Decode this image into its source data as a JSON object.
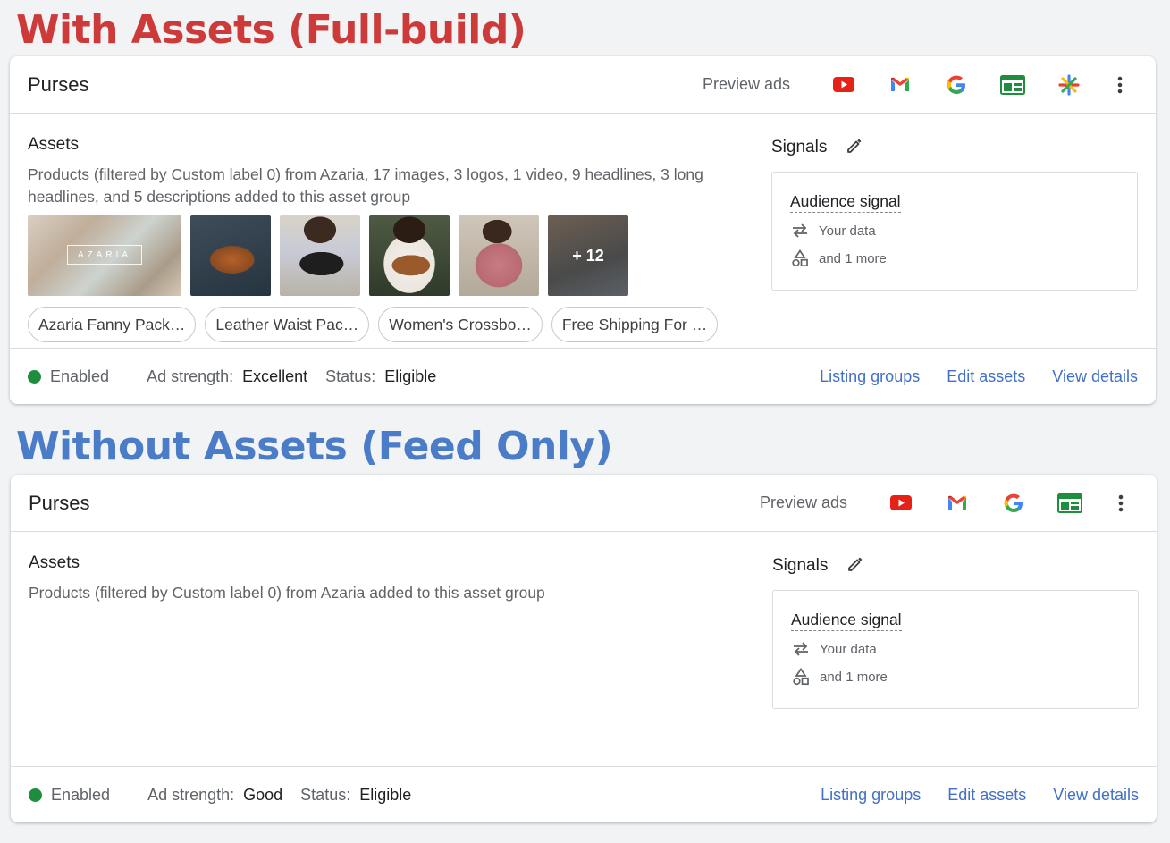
{
  "headings": {
    "with_assets": "With Assets (Full-build)",
    "without_assets": "Without Assets (Feed Only)"
  },
  "colors": {
    "heading_red": "#cc3a3a",
    "heading_blue": "#4a7cc8",
    "link_blue": "#4170c9",
    "enabled_green": "#1e8e3e"
  },
  "card1": {
    "title": "Purses",
    "preview_label": "Preview ads",
    "icons": [
      "youtube-icon",
      "gmail-icon",
      "google-search-icon",
      "display-network-icon",
      "discover-icon",
      "more-vert-icon"
    ],
    "assets_title": "Assets",
    "assets_desc": "Products (filtered by Custom label 0) from Azaria, 17 images, 3 logos, 1 video, 9 headlines, 3 long headlines, and 5 descriptions added to this asset group",
    "thumb_brand": "AZARIA",
    "thumb_more": "+ 12",
    "chips": [
      "Azaria Fanny Pack…",
      "Leather Waist Pac…",
      "Women's Crossbo…",
      "Free Shipping For …"
    ],
    "signals_title": "Signals",
    "audience_label": "Audience signal",
    "your_data": "Your data",
    "and_more": "and 1 more",
    "enabled": "Enabled",
    "ad_strength_label": "Ad strength:",
    "ad_strength_value": "Excellent",
    "status_label": "Status:",
    "status_value": "Eligible",
    "links": {
      "listing_groups": "Listing groups",
      "edit_assets": "Edit assets",
      "view_details": "View details"
    }
  },
  "card2": {
    "title": "Purses",
    "preview_label": "Preview ads",
    "icons": [
      "youtube-icon",
      "gmail-icon",
      "google-search-icon",
      "display-network-icon",
      "more-vert-icon"
    ],
    "assets_title": "Assets",
    "assets_desc": "Products (filtered by Custom label 0) from Azaria added to this asset group",
    "signals_title": "Signals",
    "audience_label": "Audience signal",
    "your_data": "Your data",
    "and_more": "and 1 more",
    "enabled": "Enabled",
    "ad_strength_label": "Ad strength:",
    "ad_strength_value": "Good",
    "status_label": "Status:",
    "status_value": "Eligible",
    "links": {
      "listing_groups": "Listing groups",
      "edit_assets": "Edit assets",
      "view_details": "View details"
    }
  }
}
